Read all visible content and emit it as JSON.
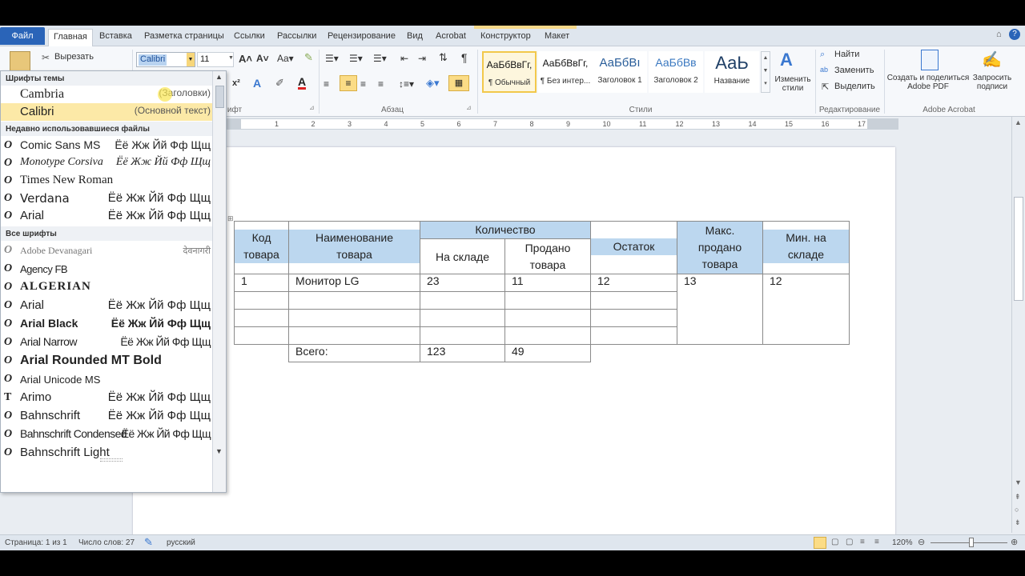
{
  "tabs": {
    "file": "Файл",
    "items": [
      "Главная",
      "Вставка",
      "Разметка страницы",
      "Ссылки",
      "Рассылки",
      "Рецензирование",
      "Вид",
      "Acrobat",
      "Конструктор",
      "Макет"
    ]
  },
  "ribbon": {
    "clipboard": {
      "cut": "Вырезать"
    },
    "font": {
      "name_value": "Calibri",
      "size_value": "11",
      "group_label": "ифт"
    },
    "paragraph": {
      "group_label": "Абзац"
    },
    "styles": {
      "group_label": "Стили",
      "tiles": [
        {
          "sample": "АаБбВвГг,",
          "name": "¶ Обычный"
        },
        {
          "sample": "АаБбВвГг,",
          "name": "¶ Без интер..."
        },
        {
          "sample": "АаБбВı",
          "name": "Заголовок 1"
        },
        {
          "sample": "АаБбВв",
          "name": "Заголовок 2"
        },
        {
          "sample": "АаЬ",
          "name": "Название"
        }
      ],
      "change_styles": "Изменить стили"
    },
    "editing": {
      "find": "Найти",
      "replace": "Заменить",
      "select": "Выделить",
      "group_label": "Редактирование"
    },
    "acrobat": {
      "create": "Создать и поделиться Adobe PDF",
      "request": "Запросить подписи",
      "group_label": "Adobe Acrobat"
    }
  },
  "ruler": {
    "ticks": [
      "1",
      "2",
      "3",
      "4",
      "5",
      "6",
      "7",
      "8",
      "9",
      "10",
      "11",
      "12",
      "13",
      "14",
      "15",
      "16",
      "17"
    ]
  },
  "font_dropdown": {
    "theme_section": "Шрифты темы",
    "theme_fonts": [
      {
        "name": "Cambria",
        "note": "(Заголовки)"
      },
      {
        "name": "Calibri",
        "note": "(Основной текст)"
      }
    ],
    "recent_section": "Недавно использовавшиеся файлы",
    "recent_fonts": [
      {
        "name": "Comic Sans MS",
        "sample": "Ёё Жж Йй Фф Щщ"
      },
      {
        "name": "Monotype Corsiva",
        "sample": "Ёё Жж Йй Фф Щщ"
      },
      {
        "name": "Times New Roman",
        "sample": ""
      },
      {
        "name": "Verdana",
        "sample": "Ёё Жж Йй Фф Щщ"
      },
      {
        "name": "Arial",
        "sample": "Ёё Жж Йй Фф Щщ"
      }
    ],
    "all_section": "Все шрифты",
    "all_fonts": [
      {
        "name": "Adobe Devanagari",
        "sample": "देवनागरी"
      },
      {
        "name": "Agency FB",
        "sample": ""
      },
      {
        "name": "ALGERIAN",
        "sample": ""
      },
      {
        "name": "Arial",
        "sample": "Ёё Жж Йй Фф Щщ"
      },
      {
        "name": "Arial Black",
        "sample": "Ёё Жж Йй Фф Щщ"
      },
      {
        "name": "Arial Narrow",
        "sample": "Ёё Жж Йй Фф Щщ"
      },
      {
        "name": "Arial Rounded MT Bold",
        "sample": ""
      },
      {
        "name": "Arial Unicode MS",
        "sample": ""
      },
      {
        "name": "Arimo",
        "sample": "Ёё Жж Йй Фф Щщ"
      },
      {
        "name": "Bahnschrift",
        "sample": "Ёё Жж Йй Фф Щщ"
      },
      {
        "name": "Bahnschrift Condensed",
        "sample": "Ёё Жж Йй Фф Щщ"
      },
      {
        "name": "Bahnschrift Light",
        "sample": ""
      }
    ]
  },
  "table": {
    "headers": {
      "code": "Код товара",
      "name": "Наименование товара",
      "quantity": "Количество",
      "in_stock": "На складе",
      "sold": "Продано товара",
      "remainder": "Остаток",
      "max_sold": "Макс. продано товара",
      "min_stock": "Мин. на складе"
    },
    "row1": {
      "code": "1",
      "name": "Монитор LG",
      "in_stock": "23",
      "sold": "11",
      "remainder": "12",
      "max_sold": "13",
      "min_stock": "12"
    },
    "total": {
      "label": "Всего:",
      "in_stock": "123",
      "sold": "49"
    }
  },
  "status": {
    "page": "Страница: 1 из 1",
    "words": "Число слов: 27",
    "language": "русский",
    "zoom": "120%"
  }
}
